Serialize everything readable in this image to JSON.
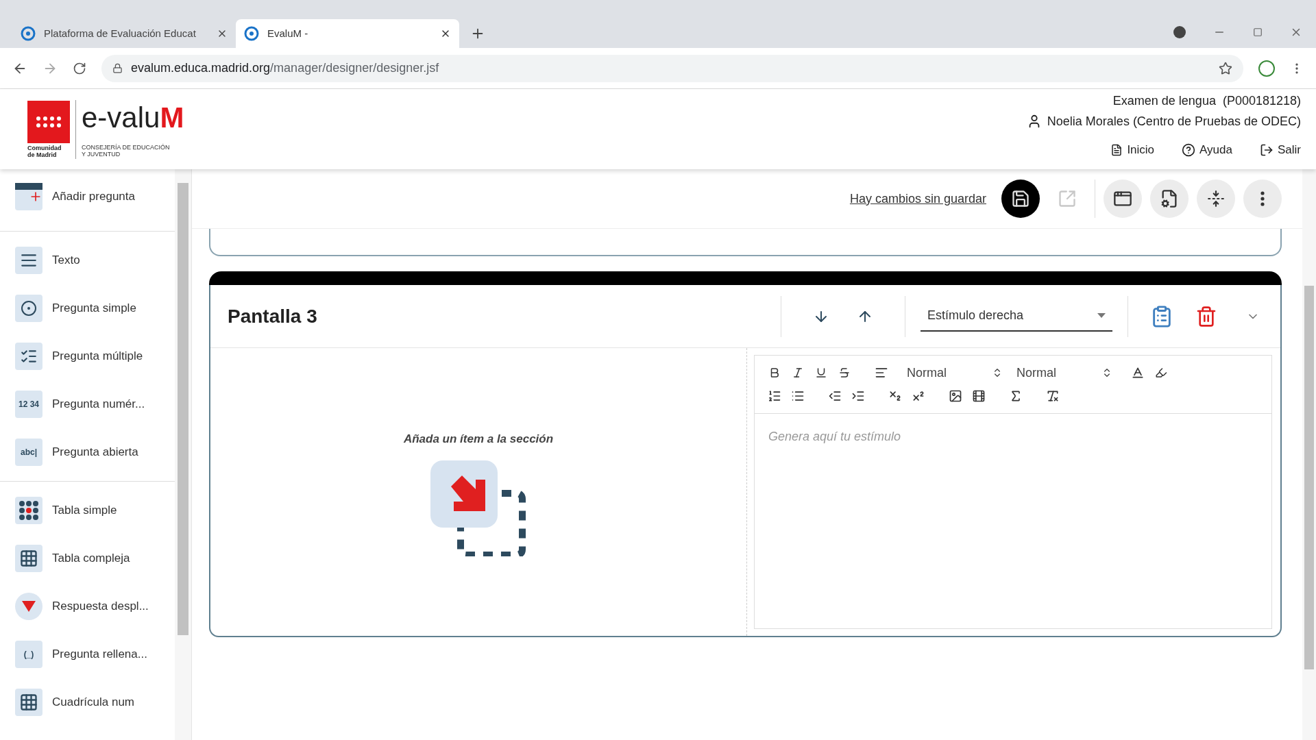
{
  "browser": {
    "tabs": [
      {
        "title": "Plataforma de Evaluación Educat",
        "selected": false
      },
      {
        "title": "EvaluM -",
        "selected": true
      }
    ],
    "url_host": "evalum.educa.madrid.org",
    "url_path": "/manager/designer/designer.jsf"
  },
  "header": {
    "logo": {
      "region_line1": "Comunidad",
      "region_line2": "de Madrid",
      "name_main": "e-valu",
      "name_accent": "M",
      "dept_line1": "CONSEJERÍA DE EDUCACIÓN",
      "dept_line2": "Y JUVENTUD"
    },
    "exam": "Examen de lengua  (P000181218)",
    "user": "Noelia Morales (Centro de Pruebas de ODEC)",
    "nav": [
      {
        "kind": "home",
        "label": "Inicio"
      },
      {
        "kind": "help",
        "label": "Ayuda"
      },
      {
        "kind": "exit",
        "label": "Salir"
      }
    ]
  },
  "sidebar": {
    "groups": [
      [
        {
          "kind": "add",
          "label": "Añadir pregunta"
        }
      ],
      [
        {
          "kind": "text",
          "label": "Texto"
        },
        {
          "kind": "single",
          "label": "Pregunta simple"
        },
        {
          "kind": "multiple",
          "label": "Pregunta múltiple"
        },
        {
          "kind": "numeric",
          "label": "Pregunta numér...",
          "icon_text": "12 34"
        },
        {
          "kind": "open",
          "label": "Pregunta abierta",
          "icon_text": "abc|"
        }
      ],
      [
        {
          "kind": "table-simple",
          "label": "Tabla simple"
        },
        {
          "kind": "table-complex",
          "label": "Tabla compleja"
        },
        {
          "kind": "dropdown",
          "label": "Respuesta despl..."
        },
        {
          "kind": "fill",
          "label": "Pregunta rellena...",
          "icon_text": "(_)"
        },
        {
          "kind": "grid",
          "label": "Cuadrícula num"
        }
      ]
    ]
  },
  "toolbar": {
    "unsaved_link": "Hay cambios sin guardar",
    "buttons": [
      {
        "kind": "save",
        "disabled": false
      },
      {
        "kind": "export",
        "disabled": true
      },
      {
        "kind": "window-settings",
        "disabled": false
      },
      {
        "kind": "doc-settings",
        "disabled": false
      },
      {
        "kind": "collapse",
        "disabled": false
      },
      {
        "kind": "more",
        "disabled": false
      }
    ]
  },
  "screen": {
    "title": "Pantalla 3",
    "layout_select": "Estímulo derecha",
    "empty_message": "Añada un ítem a la sección",
    "editor": {
      "header_select": "Normal",
      "size_select": "Normal",
      "placeholder": "Genera aquí tu estímulo"
    }
  }
}
